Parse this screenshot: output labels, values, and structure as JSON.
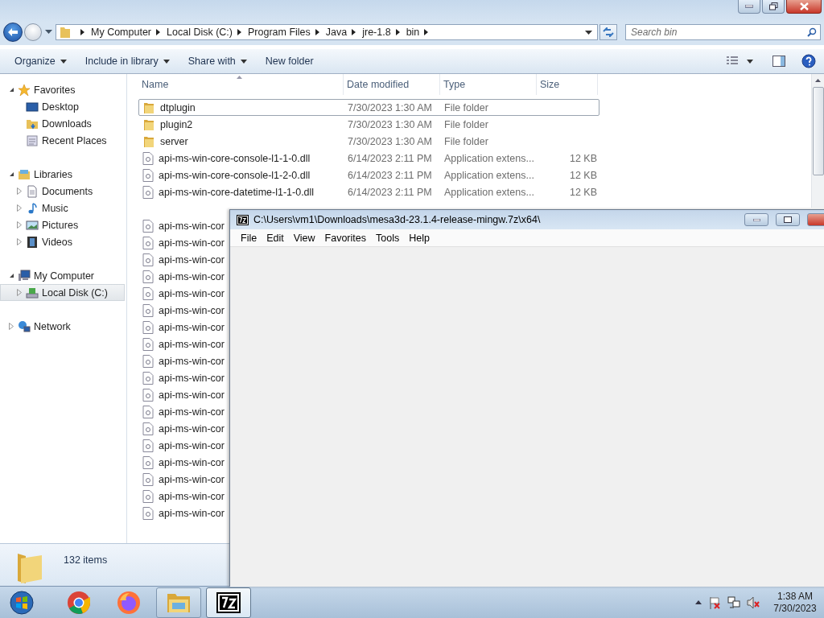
{
  "explorer": {
    "address_path": [
      "My Computer",
      "Local Disk (C:)",
      "Program Files",
      "Java",
      "jre-1.8",
      "bin"
    ],
    "search": {
      "placeholder": "Search bin"
    },
    "toolbar": [
      {
        "label": "Organize",
        "dropdown": true
      },
      {
        "label": "Include in library",
        "dropdown": true
      },
      {
        "label": "Share with",
        "dropdown": true
      },
      {
        "label": "New folder",
        "dropdown": false
      }
    ],
    "nav": [
      {
        "label": "Favorites",
        "kind": "star",
        "expanded": true,
        "selected": false,
        "children": [
          {
            "label": "Desktop",
            "kind": "desktop",
            "selected": false
          },
          {
            "label": "Downloads",
            "kind": "downloads",
            "selected": false
          },
          {
            "label": "Recent Places",
            "kind": "recent",
            "selected": false
          }
        ]
      },
      {
        "label": "Libraries",
        "kind": "library",
        "expanded": true,
        "selected": false,
        "children": [
          {
            "label": "Documents",
            "kind": "documents",
            "expanded": false,
            "selected": false
          },
          {
            "label": "Music",
            "kind": "music",
            "expanded": false,
            "selected": false
          },
          {
            "label": "Pictures",
            "kind": "pictures",
            "expanded": false,
            "selected": false
          },
          {
            "label": "Videos",
            "kind": "videos",
            "expanded": false,
            "selected": false
          }
        ]
      },
      {
        "label": "My Computer",
        "kind": "computer",
        "expanded": true,
        "selected": false,
        "children": [
          {
            "label": "Local Disk (C:)",
            "kind": "disk",
            "expanded": false,
            "selected": true
          }
        ]
      },
      {
        "label": "Network",
        "kind": "network",
        "expanded": false,
        "selected": false
      }
    ],
    "columns": [
      "Name",
      "Date modified",
      "Type",
      "Size"
    ],
    "rows": [
      {
        "kind": "folder",
        "name": "dtplugin",
        "date": "7/30/2023 1:30 AM",
        "type": "File folder",
        "focused": true
      },
      {
        "kind": "folder",
        "name": "plugin2",
        "date": "7/30/2023 1:30 AM",
        "type": "File folder",
        "focused": false
      },
      {
        "kind": "folder",
        "name": "server",
        "date": "7/30/2023 1:30 AM",
        "type": "File folder",
        "focused": false
      },
      {
        "kind": "file",
        "name": "api-ms-win-core-console-l1-1-0.dll",
        "date": "6/14/2023 2:11 PM",
        "type": "Application extens...",
        "size": "12 KB",
        "focused": false
      },
      {
        "kind": "file",
        "name": "api-ms-win-core-console-l1-2-0.dll",
        "date": "6/14/2023 2:11 PM",
        "type": "Application extens...",
        "size": "12 KB",
        "focused": false
      },
      {
        "kind": "file",
        "name": "api-ms-win-core-datetime-l1-1-0.dll",
        "date": "6/14/2023 2:11 PM",
        "type": "Application extens...",
        "size": "12 KB",
        "focused": false
      },
      {
        "kind": "file",
        "name": "api-ms-win-cor",
        "focused": false
      },
      {
        "kind": "file",
        "name": "api-ms-win-cor",
        "focused": false
      },
      {
        "kind": "file",
        "name": "api-ms-win-cor",
        "focused": false
      },
      {
        "kind": "file",
        "name": "api-ms-win-cor",
        "focused": false
      },
      {
        "kind": "file",
        "name": "api-ms-win-cor",
        "focused": false
      },
      {
        "kind": "file",
        "name": "api-ms-win-cor",
        "focused": false
      },
      {
        "kind": "file",
        "name": "api-ms-win-cor",
        "focused": false
      },
      {
        "kind": "file",
        "name": "api-ms-win-cor",
        "focused": false
      },
      {
        "kind": "file",
        "name": "api-ms-win-cor",
        "focused": false
      },
      {
        "kind": "file",
        "name": "api-ms-win-cor",
        "focused": false
      },
      {
        "kind": "file",
        "name": "api-ms-win-cor",
        "focused": false
      },
      {
        "kind": "file",
        "name": "api-ms-win-cor",
        "focused": false
      },
      {
        "kind": "file",
        "name": "api-ms-win-cor",
        "focused": false
      },
      {
        "kind": "file",
        "name": "api-ms-win-cor",
        "focused": false
      },
      {
        "kind": "file",
        "name": "api-ms-win-cor",
        "focused": false
      },
      {
        "kind": "file",
        "name": "api-ms-win-cor",
        "focused": false
      },
      {
        "kind": "file",
        "name": "api-ms-win-cor",
        "focused": false
      },
      {
        "kind": "file",
        "name": "api-ms-win-cor",
        "focused": false
      }
    ],
    "status": "132 items"
  },
  "archive_window": {
    "title": "C:\\Users\\vm1\\Downloads\\mesa3d-23.1.4-release-mingw.7z\\x64\\",
    "menu": [
      "File",
      "Edit",
      "View",
      "Favorites",
      "Tools",
      "Help"
    ]
  },
  "taskbar": {
    "items": [
      {
        "kind": "chrome",
        "selected": false
      },
      {
        "kind": "firefox",
        "selected": false
      },
      {
        "kind": "explorer",
        "selected": false
      },
      {
        "kind": "sevenzip",
        "selected": true
      }
    ],
    "time": "1:38 AM",
    "date": "7/30/2023"
  }
}
